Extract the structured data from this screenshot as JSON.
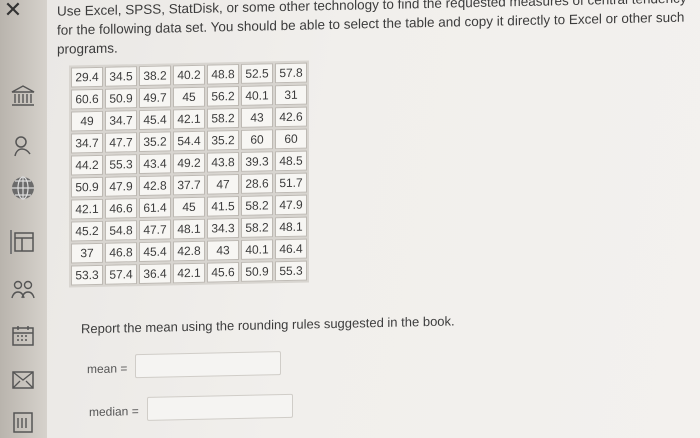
{
  "close_symbol": "✕",
  "sidebar_icons": [
    "bank-icon",
    "user-icon",
    "globe-icon",
    "layout-icon",
    "people-icon",
    "calendar-icon",
    "mail-icon",
    "book-icon"
  ],
  "question": {
    "instructions": "Use Excel, SPSS, StatDisk, or some other technology to find the requested measures of central tendency for the following data set. You should be able to select the table and copy it directly to Excel or other such programs.",
    "table": [
      [
        "29.4",
        "34.5",
        "38.2",
        "40.2",
        "48.8",
        "52.5",
        "57.8"
      ],
      [
        "60.6",
        "50.9",
        "49.7",
        "45",
        "56.2",
        "40.1",
        "31"
      ],
      [
        "49",
        "34.7",
        "45.4",
        "42.1",
        "58.2",
        "43",
        "42.6"
      ],
      [
        "34.7",
        "47.7",
        "35.2",
        "54.4",
        "35.2",
        "60",
        "60"
      ],
      [
        "44.2",
        "55.3",
        "43.4",
        "49.2",
        "43.8",
        "39.3",
        "48.5"
      ],
      [
        "50.9",
        "47.9",
        "42.8",
        "37.7",
        "47",
        "28.6",
        "51.7"
      ],
      [
        "42.1",
        "46.6",
        "61.4",
        "45",
        "41.5",
        "58.2",
        "47.9"
      ],
      [
        "45.2",
        "54.8",
        "47.7",
        "48.1",
        "34.3",
        "58.2",
        "48.1"
      ],
      [
        "37",
        "46.8",
        "45.4",
        "42.8",
        "43",
        "40.1",
        "46.4"
      ],
      [
        "53.3",
        "57.4",
        "36.4",
        "42.1",
        "45.6",
        "50.9",
        "55.3"
      ]
    ],
    "report_text": "Report the mean using the rounding rules suggested in the book.",
    "mean_label": "mean =",
    "mean_value": "",
    "median_label": "median =",
    "median_value": ""
  }
}
